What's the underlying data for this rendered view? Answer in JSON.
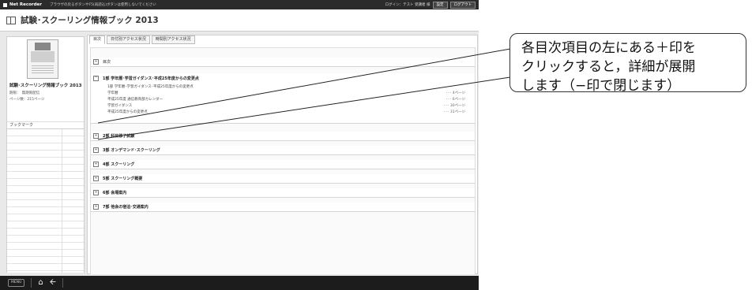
{
  "topbar": {
    "app_name": "Net Recorder",
    "notice": "ブラウザの戻るボタンやF5(再読込)ボタンは使用しないでください",
    "user_info": "ログイン：テスト 受講者 様",
    "btn1": "設定",
    "btn2": "ログアウト"
  },
  "title": "試験･スクーリング情報ブック 2013",
  "sidebar": {
    "book_title": "試験･スクーリング情報ブック 2013",
    "meta1": "期限：　無期限配信",
    "meta2": "ページ数：215ページ",
    "bookmark_header": "ブックマーク"
  },
  "tabs": [
    "目次",
    "日付別アクセス状況",
    "時間別アクセス状況"
  ],
  "toc": {
    "rows": [
      {
        "sign": "+",
        "label": "目次"
      },
      {
        "sign": "+",
        "label": "2部  科目修了試験"
      },
      {
        "sign": "+",
        "label": "3部  オンデマンド･スクーリング"
      },
      {
        "sign": "+",
        "label": "4部  スクーリング"
      },
      {
        "sign": "+",
        "label": "5部  スクーリング概要"
      },
      {
        "sign": "+",
        "label": "6部  会場案内"
      },
      {
        "sign": "+",
        "label": "7部  他会の宿泊･交通案内"
      }
    ],
    "expanded": {
      "sign": "−",
      "label": "1部  学年暦･学習ガイダンス･平成25年度からの変更点",
      "items": [
        {
          "text": "1部  学年暦･学習ガイダンス･平成25年度からの変更点",
          "page": ""
        },
        {
          "text": "学年暦",
          "page": "･･･ 4ページ"
        },
        {
          "text": "平成25年度  通信教育部カレンダー",
          "page": "･･･ 6ページ"
        },
        {
          "text": "学習ガイダンス",
          "page": "･･･ 30ページ"
        },
        {
          "text": "平成25年度からの変更点",
          "page": "･･･ 31ページ"
        }
      ]
    }
  },
  "bottombar": {
    "menu": "MENU"
  },
  "callout": {
    "line1": "各目次項目の左にある＋印を",
    "line2": "クリックすると，詳細が展開",
    "line3": "します（−印で閉じます）"
  }
}
